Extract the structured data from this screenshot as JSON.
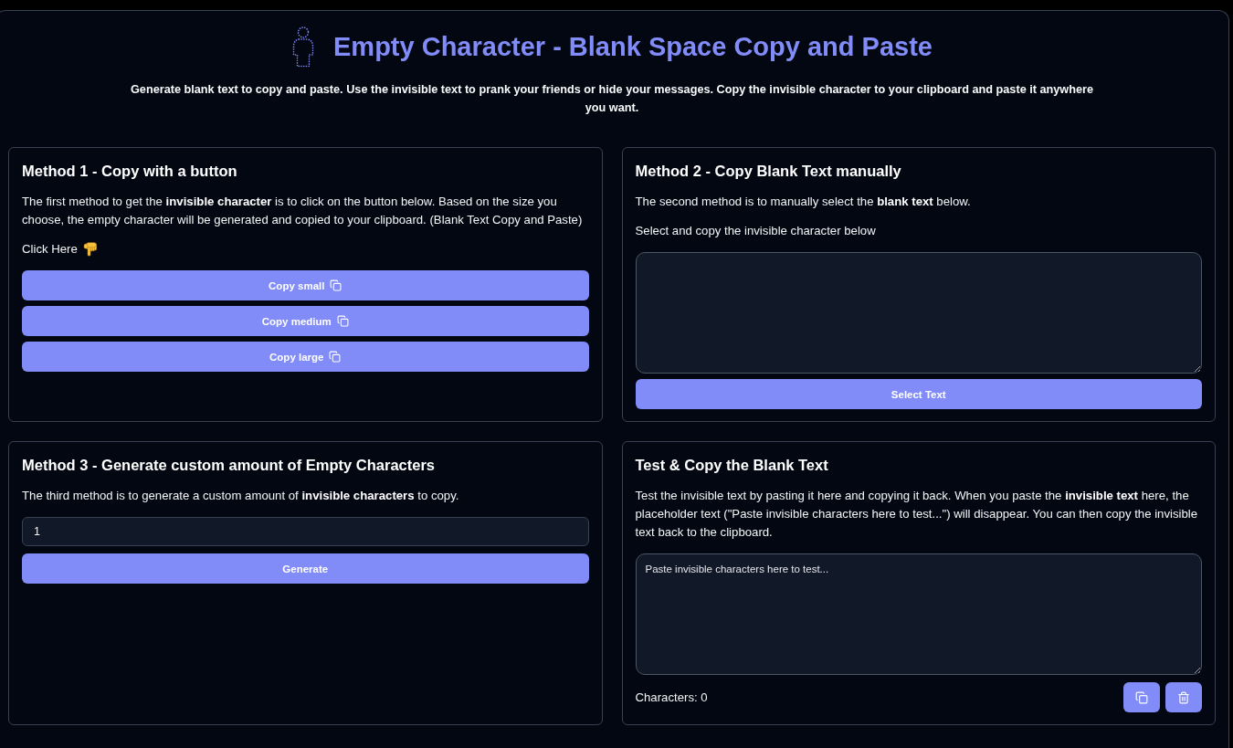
{
  "header": {
    "title": "Empty Character - Blank Space Copy and Paste",
    "subtitle": "Generate blank text to copy and paste. Use the invisible text to prank your friends or hide your messages. Copy the invisible character to your clipboard and paste it anywhere you want."
  },
  "cards": [
    {
      "kind": "buttons",
      "title": "Method 1 - Copy with a button",
      "description": "The first method to get the **invisible character** is to click on the button below. Based on the size you choose, the empty character will be generated and copied to your clipboard. (Blank Text Copy and Paste)",
      "prompt": "Click Here",
      "buttons": [
        "Copy small",
        "Copy medium",
        "Copy large"
      ]
    },
    {
      "kind": "select",
      "title": "Method 2 - Copy Blank Text manually",
      "description": "The second method is to manually select the **blank text** below.",
      "prompt": "Select and copy the invisible character below",
      "button": "Select Text"
    },
    {
      "kind": "generate",
      "title": "Method 3 - Generate custom amount of Empty Characters",
      "description": "The third method is to generate a custom amount of **invisible characters** to copy.",
      "input": {
        "value": "1"
      },
      "button": "Generate"
    },
    {
      "kind": "test",
      "title": "Test & Copy the Blank Text",
      "description": "Test the invisible text by pasting it here and copying it back. When you paste the **invisible text** here, the placeholder text (\"Paste invisible characters here to test...\") will disappear. You can then copy the invisible text back to the clipboard.",
      "textarea": {
        "placeholder": "Paste invisible characters here to test..."
      },
      "counter": "Characters: 0"
    }
  ]
}
